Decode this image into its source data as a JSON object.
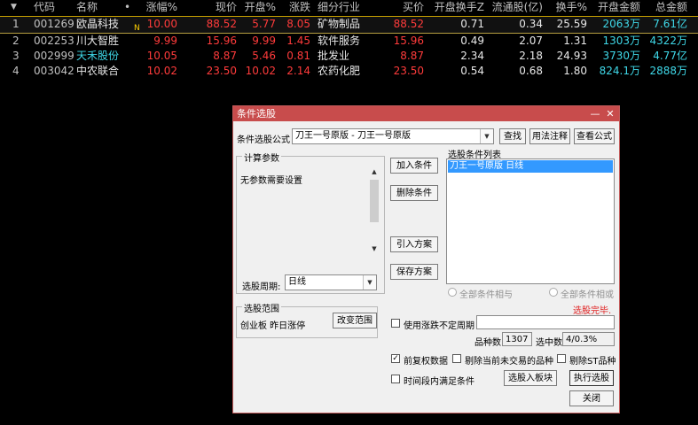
{
  "table": {
    "header": {
      "sort_icon": "▼",
      "code": "代码",
      "name": "名称",
      "dot": "•",
      "pct": "涨幅%",
      "price": "现价",
      "open_pct": "开盘%",
      "change": "涨跌",
      "industry": "细分行业",
      "bid": "买价",
      "open_turnover": "开盘换手Z",
      "float_shares": "流通股(亿)",
      "turnover": "换手%",
      "open_amount": "开盘金额",
      "total_amount": "总金额"
    },
    "rows": [
      {
        "idx": "1",
        "code": "001269",
        "name": "欧晶科技",
        "flag": "N",
        "pct": "10.00",
        "price": "88.52",
        "open_pct": "5.77",
        "change": "8.05",
        "industry": "矿物制品",
        "bid": "88.52",
        "open_turnover": "0.71",
        "float_shares": "0.34",
        "turnover": "25.59",
        "open_amount": "2063万",
        "total_amount": "7.61亿"
      },
      {
        "idx": "2",
        "code": "002253",
        "name": "川大智胜",
        "flag": "",
        "pct": "9.99",
        "price": "15.96",
        "open_pct": "9.99",
        "change": "1.45",
        "industry": "软件服务",
        "bid": "15.96",
        "open_turnover": "0.49",
        "float_shares": "2.07",
        "turnover": "1.31",
        "open_amount": "1303万",
        "total_amount": "4322万"
      },
      {
        "idx": "3",
        "code": "002999",
        "name": "天禾股份",
        "flag": "",
        "pct": "10.05",
        "price": "8.87",
        "open_pct": "5.46",
        "change": "0.81",
        "industry": "批发业",
        "bid": "8.87",
        "open_turnover": "2.34",
        "float_shares": "2.18",
        "turnover": "24.93",
        "open_amount": "3730万",
        "total_amount": "4.77亿"
      },
      {
        "idx": "4",
        "code": "003042",
        "name": "中农联合",
        "flag": "",
        "pct": "10.02",
        "price": "23.50",
        "open_pct": "10.02",
        "change": "2.14",
        "industry": "农药化肥",
        "bid": "23.50",
        "open_turnover": "0.54",
        "float_shares": "0.68",
        "turnover": "1.80",
        "open_amount": "824.1万",
        "total_amount": "2888万"
      }
    ]
  },
  "dialog": {
    "title": "条件选股",
    "minimize_icon": "—",
    "close_icon": "✕",
    "formula_label": "条件选股公式",
    "formula_value": "刀王一号原版 - 刀王一号原版",
    "find_btn": "查找",
    "usage_btn": "用法注释",
    "view_formula_btn": "查看公式",
    "params_group": "计算参数",
    "params_text": "无参数需要设置",
    "period_label": "选股周期:",
    "period_value": "日线",
    "add_btn": "加入条件",
    "delete_btn": "删除条件",
    "import_btn": "引入方案",
    "save_btn": "保存方案",
    "cond_list_label": "选股条件列表",
    "cond_item": "刀王一号原版  日线",
    "radio_and": "全部条件相与",
    "radio_or": "全部条件相或",
    "status": "选股完毕.",
    "range_group": "选股范围",
    "range_text": "创业板 昨日涨停",
    "change_range_btn": "改变范围",
    "use_unfixed_label": "使用涨跌不定周期",
    "count_label": "品种数",
    "count_value": "1307",
    "selected_label": "选中数",
    "selected_value": "4/0.3%",
    "prev_rights_label": "前复权数据",
    "exclude_untraded_label": "剔除当前未交易的品种",
    "exclude_st_label": "剔除ST品种",
    "time_cond_label": "时间段内满足条件",
    "to_block_btn": "选股入板块",
    "run_btn": "执行选股",
    "close_btn": "关闭"
  },
  "colors": {
    "up": "#ff3b3b",
    "cyan": "#3fd8e8",
    "title_bar": "#c84c4c",
    "selection": "#3399ff"
  }
}
